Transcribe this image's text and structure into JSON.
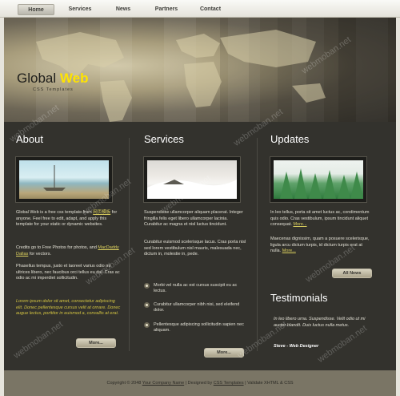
{
  "nav": {
    "items": [
      "Home",
      "Services",
      "News",
      "Partners",
      "Contact"
    ],
    "active": "Home"
  },
  "header": {
    "title_part1": "Global",
    "title_part2": "Web",
    "subtitle": "CSS Templates"
  },
  "about": {
    "heading": "About",
    "p1_before": "Global Web is a free css template from ",
    "p1_link": "网页模板",
    "p1_after": " for anyone. Feel free to edit, adapt, and apply this template for your static or dynamic websites.",
    "p2_before": "Credits go to Free Photos for photos, and ",
    "p2_link": "MacDaddy Dallas",
    "p2_after": " for vectors.",
    "p3": "Phasellus tempus, justo et laoreet varius odio mi ultrices libero, nec faucibus orci tellus eu dui. Cras ac odio ac mi imperdiet sollicitudin.",
    "italic": "Lorem ipsum dolor sit amet, consectetur adipiscing elit. Donec pellentesque cursus velit at ornare. Donec augue lectus, porttitor in euismod a, convallis at erat.",
    "button": "More..."
  },
  "services": {
    "heading": "Services",
    "p1": "Suspendisse ullamcorper aliquam placerat. Integer fringilla felis eget libero ullamcorper lacinia. Curabitur ac magna et nisl luctus tincidunt.",
    "p2": "Curabitur euismod scelerisque lacus. Cras porta nisl sed lorem vestibulum nisl mauris, malesuada nec, dictum in, molestie in, pede.",
    "bullets": [
      "Morbi vel nulla ac est cursus suscipit eu ac lectus.",
      "Curabitur ullamcorper nibh nisi, sed eleifend dolor.",
      "Pellentesque adipiscing sollicitudin sapien nec aliquam."
    ],
    "button": "More..."
  },
  "updates": {
    "heading": "Updates",
    "p1": "In leo tellus, porta sit amet luctus ac, condimentum quis odio. Cras vestibulum, ipsum tincidunt aliquet consequat. ",
    "p1_link": "More...",
    "p2": "Maecenas dignissim, quam a posuere scelerisque, ligula arcu dictum turpis, id dictum turpis erat at nulla. ",
    "p2_link": "More...",
    "button": "All News"
  },
  "testimonials": {
    "heading": "Testimonials",
    "quote": "In leo libero urna. Suspendisse. Velit odio ut mi auctor blandit. Duis luctus nulla metus.",
    "author": "Steve - Web Designer"
  },
  "footer": {
    "prefix": "Copyright © 2048 ",
    "company": "Your Company Name",
    "mid": " | Designed by ",
    "designer": "CSS Templates",
    "suffix": " | Validate XHTML & CSS"
  },
  "watermark": "webmoban.net",
  "colors": {
    "accent_yellow": "#ffe400",
    "dark_bg": "#33322d",
    "link_yellow": "#dcd05f"
  }
}
